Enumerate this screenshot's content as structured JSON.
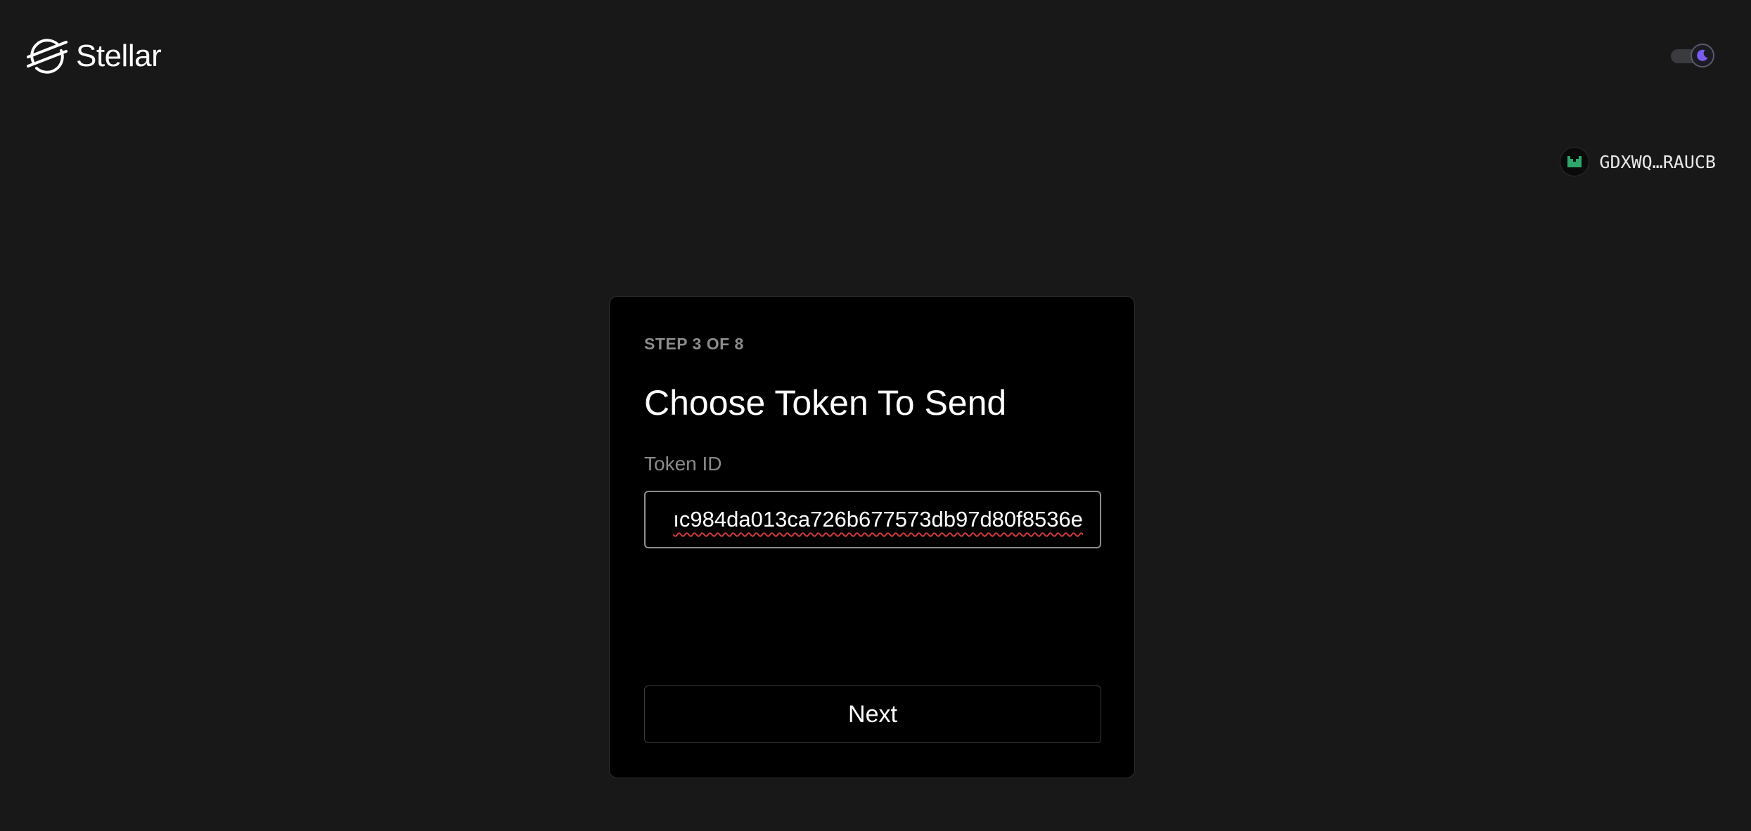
{
  "header": {
    "brand": "Stellar",
    "theme": "dark",
    "account_address": "GDXWQ…RAUCB"
  },
  "card": {
    "step_label": "STEP 3 OF 8",
    "title": "Choose Token To Send",
    "token_field": {
      "label": "Token ID",
      "visible_value": "ıc984da013ca726b677573db97d80f8536e"
    },
    "next_label": "Next"
  },
  "colors": {
    "background": "#181818",
    "card": "#000000",
    "accent": "#7b5cf0",
    "avatar_green": "#2fa66a"
  },
  "icons": {
    "logo": "stellar-logo-icon",
    "theme": "moon-icon",
    "avatar": "identicon-icon"
  }
}
